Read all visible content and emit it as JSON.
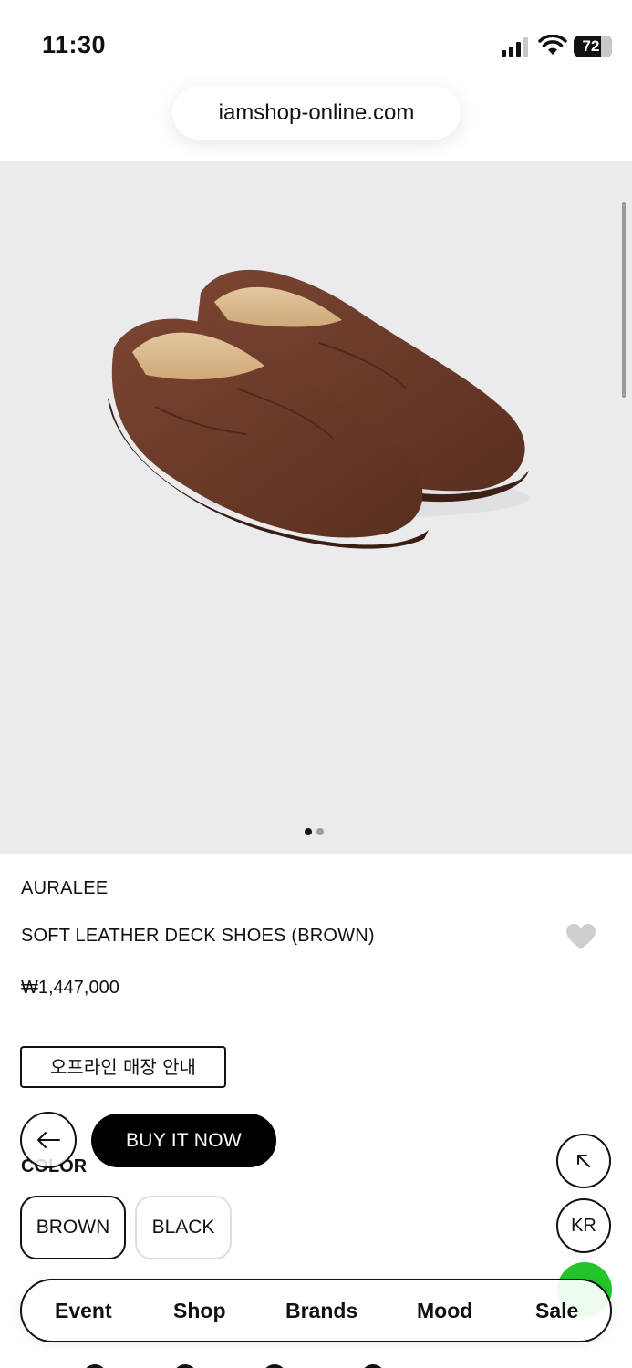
{
  "status_bar": {
    "time": "11:30",
    "battery": "72",
    "battery_level": 0.72,
    "icons": [
      "signal-icon",
      "wifi-icon",
      "battery-icon"
    ]
  },
  "browser": {
    "url": "iamshop-online.com"
  },
  "gallery": {
    "image_subject": "brown leather deck shoes",
    "page_count": 2,
    "current_page": 1
  },
  "product": {
    "brand": "AURALEE",
    "name": "SOFT LEATHER DECK SHOES (BROWN)",
    "price": "₩1,447,000",
    "store_guide_label": "오프라인 매장 안내",
    "wishlist_icon": "heart-icon"
  },
  "actions": {
    "back_icon": "arrow-left-icon",
    "buy_label": "BUY IT NOW"
  },
  "color": {
    "label": "COLOR",
    "options": [
      {
        "label": "BROWN",
        "selected": true
      },
      {
        "label": "BLACK",
        "selected": false
      }
    ]
  },
  "floating": {
    "top_icon": "arrow-up-left-icon",
    "lang_label": "KR",
    "chat_color": "#22c62a"
  },
  "bottom_nav": {
    "items": [
      "Event",
      "Shop",
      "Brands",
      "Mood",
      "Sale"
    ]
  },
  "colors": {
    "primary": "#000000",
    "image_background": "#ebebed",
    "heart": "#cfcfcf"
  }
}
